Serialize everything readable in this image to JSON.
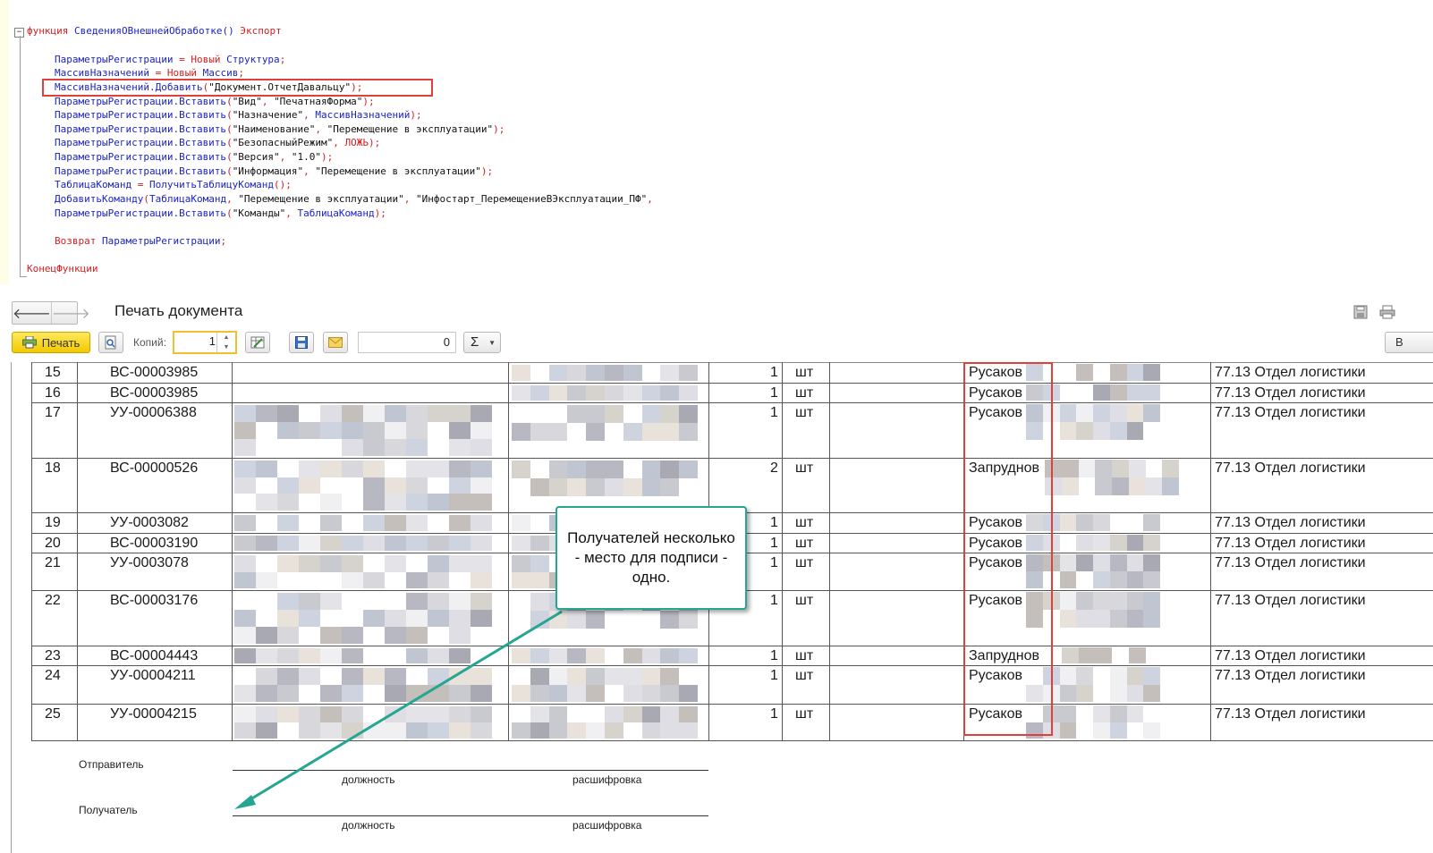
{
  "code": {
    "lines": [
      {
        "parts": [
          {
            "t": "функция ",
            "c": "kw"
          },
          {
            "t": "СведенияОВнешнейОбработке() ",
            "c": "id"
          },
          {
            "t": "Экспорт",
            "c": "kw"
          }
        ]
      },
      {
        "parts": []
      },
      {
        "parts": [
          {
            "t": "ПараметрыРегистрации",
            "c": "id"
          },
          {
            "t": " = ",
            "c": "op"
          },
          {
            "t": "Новый ",
            "c": "kw"
          },
          {
            "t": "Структура",
            "c": "id"
          },
          {
            "t": ";",
            "c": "op"
          }
        ]
      },
      {
        "parts": [
          {
            "t": "МассивНазначений",
            "c": "id"
          },
          {
            "t": " = ",
            "c": "op"
          },
          {
            "t": "Новый ",
            "c": "kw"
          },
          {
            "t": "Массив",
            "c": "id"
          },
          {
            "t": ";",
            "c": "op"
          }
        ]
      },
      {
        "parts": [
          {
            "t": "МассивНазначений.Добавить",
            "c": "id"
          },
          {
            "t": "(",
            "c": "op"
          },
          {
            "t": "\"Документ.ОтчетДавальцу\"",
            "c": "st"
          },
          {
            "t": ");",
            "c": "op"
          }
        ]
      },
      {
        "parts": [
          {
            "t": "ПараметрыРегистрации.Вставить",
            "c": "id"
          },
          {
            "t": "(",
            "c": "op"
          },
          {
            "t": "\"Вид\"",
            "c": "st"
          },
          {
            "t": ", ",
            "c": "op"
          },
          {
            "t": "\"ПечатнаяФорма\"",
            "c": "st"
          },
          {
            "t": ");",
            "c": "op"
          }
        ]
      },
      {
        "parts": [
          {
            "t": "ПараметрыРегистрации.Вставить",
            "c": "id"
          },
          {
            "t": "(",
            "c": "op"
          },
          {
            "t": "\"Назначение\"",
            "c": "st"
          },
          {
            "t": ", ",
            "c": "op"
          },
          {
            "t": "МассивНазначений",
            "c": "id"
          },
          {
            "t": ");",
            "c": "op"
          }
        ]
      },
      {
        "parts": [
          {
            "t": "ПараметрыРегистрации.Вставить",
            "c": "id"
          },
          {
            "t": "(",
            "c": "op"
          },
          {
            "t": "\"Наименование\"",
            "c": "st"
          },
          {
            "t": ", ",
            "c": "op"
          },
          {
            "t": "\"Перемещение в эксплуатации\"",
            "c": "st"
          },
          {
            "t": ");",
            "c": "op"
          }
        ]
      },
      {
        "parts": [
          {
            "t": "ПараметрыРегистрации.Вставить",
            "c": "id"
          },
          {
            "t": "(",
            "c": "op"
          },
          {
            "t": "\"БезопасныйРежим\"",
            "c": "st"
          },
          {
            "t": ", ",
            "c": "op"
          },
          {
            "t": "ЛОЖЬ",
            "c": "kw"
          },
          {
            "t": ");",
            "c": "op"
          }
        ]
      },
      {
        "parts": [
          {
            "t": "ПараметрыРегистрации.Вставить",
            "c": "id"
          },
          {
            "t": "(",
            "c": "op"
          },
          {
            "t": "\"Версия\"",
            "c": "st"
          },
          {
            "t": ", ",
            "c": "op"
          },
          {
            "t": "\"1.0\"",
            "c": "st"
          },
          {
            "t": ");",
            "c": "op"
          }
        ]
      },
      {
        "parts": [
          {
            "t": "ПараметрыРегистрации.Вставить",
            "c": "id"
          },
          {
            "t": "(",
            "c": "op"
          },
          {
            "t": "\"Информация\"",
            "c": "st"
          },
          {
            "t": ", ",
            "c": "op"
          },
          {
            "t": "\"Перемещение в эксплуатации\"",
            "c": "st"
          },
          {
            "t": ");",
            "c": "op"
          }
        ]
      },
      {
        "parts": [
          {
            "t": "ТаблицаКоманд",
            "c": "id"
          },
          {
            "t": " = ",
            "c": "op"
          },
          {
            "t": "ПолучитьТаблицуКоманд",
            "c": "id"
          },
          {
            "t": "();",
            "c": "op"
          }
        ]
      },
      {
        "parts": [
          {
            "t": "ДобавитьКоманду",
            "c": "id"
          },
          {
            "t": "(",
            "c": "op"
          },
          {
            "t": "ТаблицаКоманд",
            "c": "id"
          },
          {
            "t": ", ",
            "c": "op"
          },
          {
            "t": "\"Перемещение в эксплуатации\"",
            "c": "st"
          },
          {
            "t": ", ",
            "c": "op"
          },
          {
            "t": "\"Инфостарт_ПеремещениеВЭксплуатации_ПФ\"",
            "c": "st"
          },
          {
            "t": ",",
            "c": "op"
          }
        ]
      },
      {
        "parts": [
          {
            "t": "ПараметрыРегистрации.Вставить",
            "c": "id"
          },
          {
            "t": "(",
            "c": "op"
          },
          {
            "t": "\"Команды\"",
            "c": "st"
          },
          {
            "t": ", ",
            "c": "op"
          },
          {
            "t": "ТаблицаКоманд",
            "c": "id"
          },
          {
            "t": ");",
            "c": "op"
          }
        ]
      },
      {
        "parts": []
      },
      {
        "parts": [
          {
            "t": "Возврат ",
            "c": "kw"
          },
          {
            "t": "ПараметрыРегистрации",
            "c": "id"
          },
          {
            "t": ";",
            "c": "op"
          }
        ]
      },
      {
        "parts": []
      },
      {
        "parts": [
          {
            "t": "КонецФункции",
            "c": "kw"
          }
        ]
      }
    ]
  },
  "document": {
    "title": "Печать документа",
    "print_label": "Печать",
    "copies_label": "Копий:",
    "copies_value": "1",
    "sum_field_value": "0",
    "sum_symbol": "Σ",
    "edge_button_label": "В"
  },
  "table": {
    "rows": [
      {
        "n": "15",
        "code": "ВС-00003985",
        "qty": "1",
        "unit": "шт",
        "recipient": "Русаков",
        "dept": "77.13 Отдел логистики"
      },
      {
        "n": "16",
        "code": "ВС-00003985",
        "qty": "1",
        "unit": "шт",
        "recipient": "Русаков",
        "dept": "77.13 Отдел логистики"
      },
      {
        "n": "17",
        "code": "УУ-00006388",
        "qty": "1",
        "unit": "шт",
        "recipient": "Русаков",
        "dept": "77.13 Отдел логистики"
      },
      {
        "n": "18",
        "code": "ВС-00000526",
        "qty": "2",
        "unit": "шт",
        "recipient": "Запруднов",
        "dept": "77.13 Отдел логистики"
      },
      {
        "n": "19",
        "code": "УУ-0003082",
        "qty": "1",
        "unit": "шт",
        "recipient": "Русаков",
        "dept": "77.13 Отдел логистики"
      },
      {
        "n": "20",
        "code": "ВС-00003190",
        "qty": "1",
        "unit": "шт",
        "recipient": "Русаков",
        "dept": "77.13 Отдел логистики"
      },
      {
        "n": "21",
        "code": "УУ-0003078",
        "qty": "1",
        "unit": "шт",
        "recipient": "Русаков",
        "dept": "77.13 Отдел логистики"
      },
      {
        "n": "22",
        "code": "ВС-00003176",
        "qty": "1",
        "unit": "шт",
        "recipient": "Русаков",
        "dept": "77.13 Отдел логистики"
      },
      {
        "n": "23",
        "code": "ВС-00004443",
        "qty": "1",
        "unit": "шт",
        "recipient": "Запруднов",
        "dept": "77.13 Отдел логистики"
      },
      {
        "n": "24",
        "code": "УУ-00004211",
        "qty": "1",
        "unit": "шт",
        "recipient": "Русаков",
        "dept": "77.13 Отдел логистики"
      },
      {
        "n": "25",
        "code": "УУ-00004215",
        "qty": "1",
        "unit": "шт",
        "recipient": "Русаков",
        "dept": "77.13 Отдел логистики"
      }
    ]
  },
  "signatures": {
    "sender_label": "Отправитель",
    "recipient_label": "Получатель",
    "position_caption": "должность",
    "decode_caption": "расшифровка"
  },
  "callout": {
    "text": "Получателей несколько - место для подписи - одно."
  },
  "colors": {
    "highlight_red": "#e0403c",
    "callout_teal": "#25a592",
    "code_keyword": "#d42020",
    "code_identifier": "#1b24c4"
  }
}
